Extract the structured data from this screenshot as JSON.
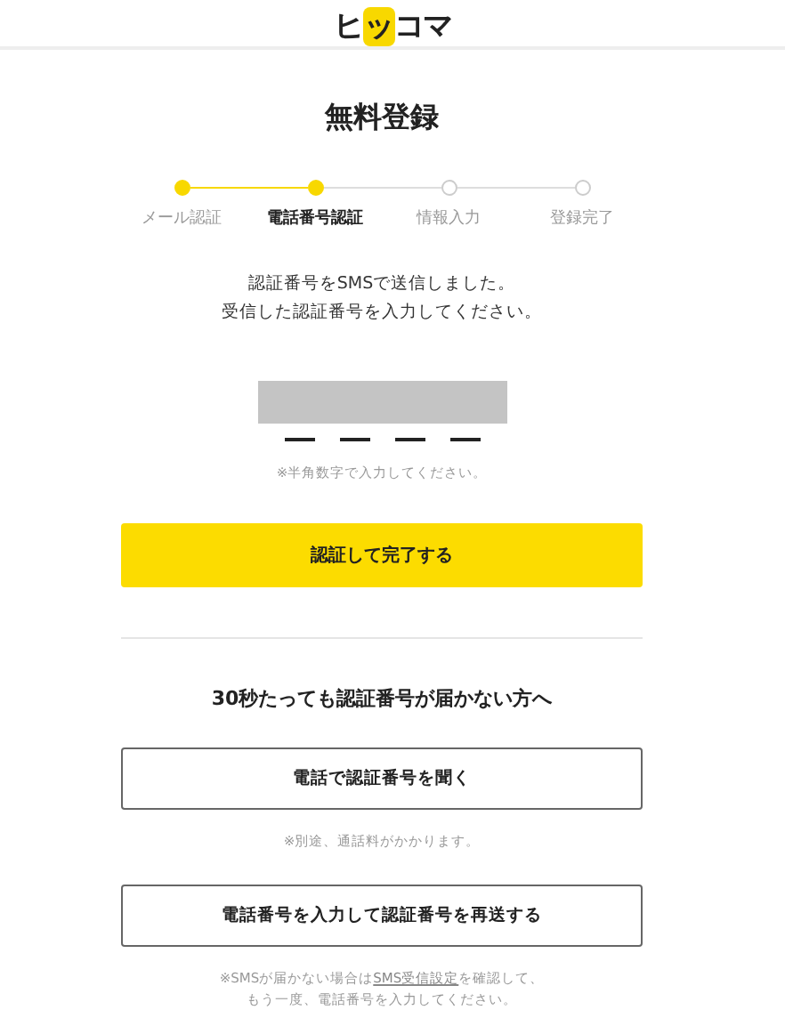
{
  "header": {
    "logo": [
      "ヒ",
      "ッ",
      "コマ"
    ]
  },
  "title": "無料登録",
  "steps": [
    {
      "label": "メール認証",
      "completed": true,
      "selected": false
    },
    {
      "label": "電話番号認証",
      "completed": true,
      "selected": true
    },
    {
      "label": "情報入力",
      "completed": false,
      "selected": false
    },
    {
      "label": "登録完了",
      "completed": false,
      "selected": false
    }
  ],
  "message": [
    "認証番号をSMSで送信しました。",
    "受信した認証番号を入力してください。"
  ],
  "code_hint": "※半角数字で入力してください。",
  "submit_button": "認証して完了する",
  "help": {
    "heading": "30秒たっても認証番号が届かない方へ",
    "call_button": "電話で認証番号を聞く",
    "call_note": "※別途、通話料がかかります。",
    "resend_button": "電話番号を入力して認証番号を再送する",
    "resend_note": {
      "before": "※SMSが届かない場合は",
      "link": "SMS受信設定",
      "after": "を確認して、",
      "line2": "もう一度、電話番号を入力してください。"
    }
  }
}
